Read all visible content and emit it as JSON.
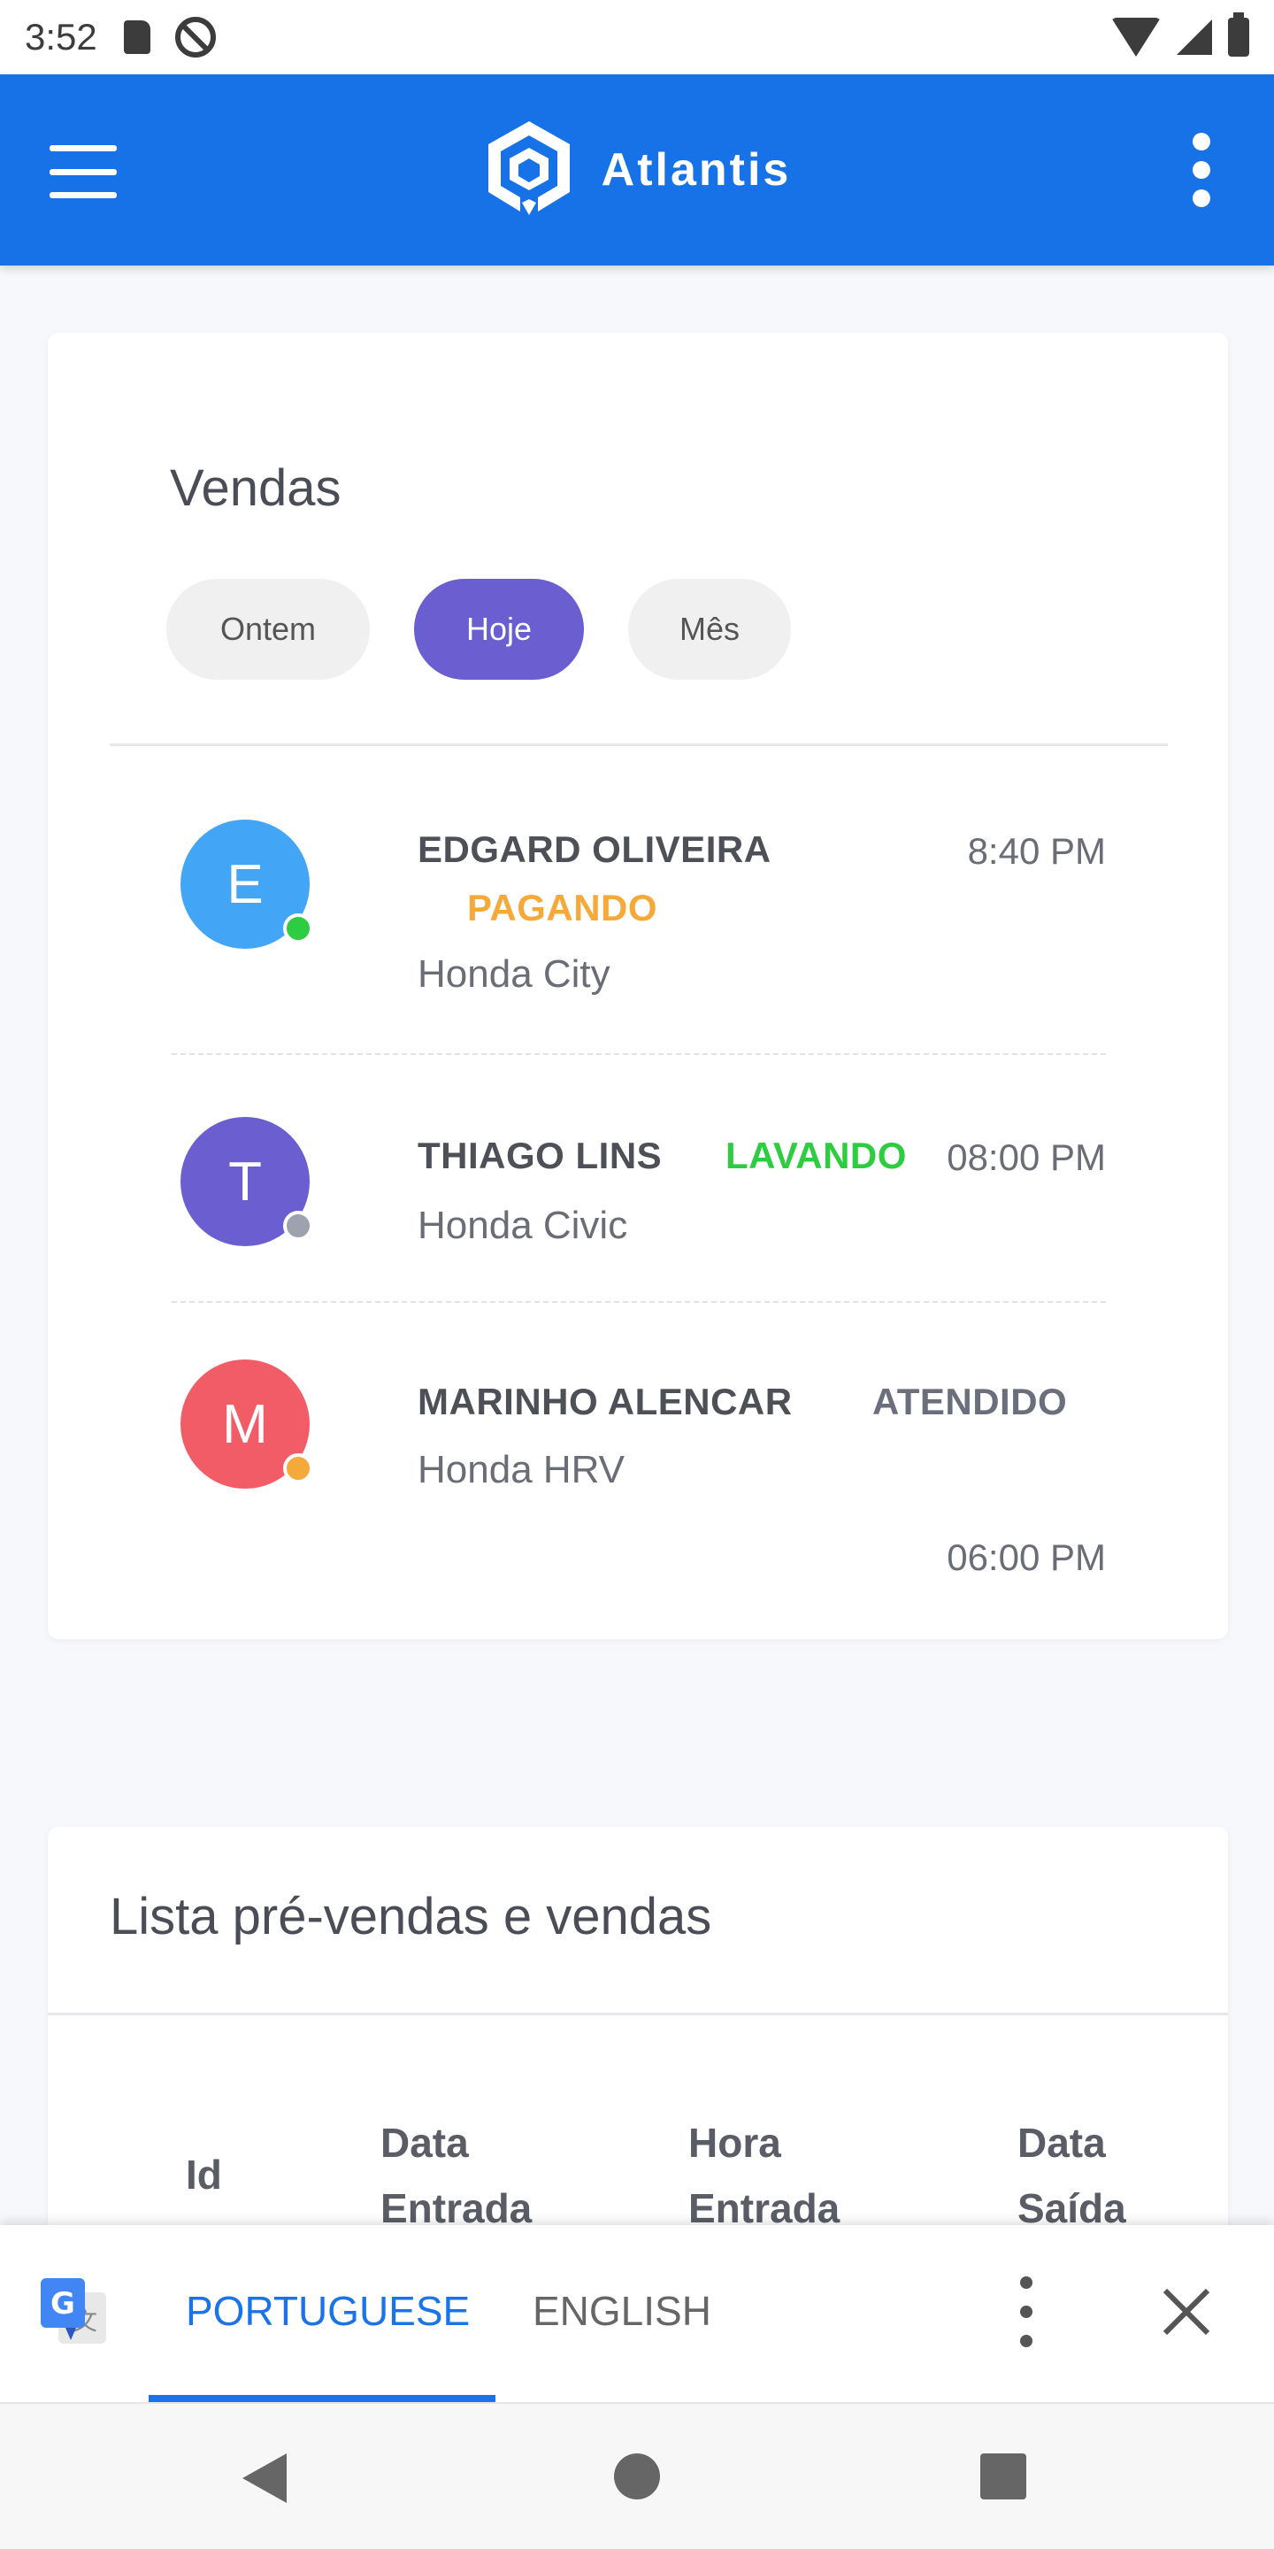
{
  "status_bar": {
    "time": "3:52"
  },
  "app_bar": {
    "title": "Atlantis"
  },
  "sales": {
    "title": "Vendas",
    "filters": [
      "Ontem",
      "Hoje",
      "Mês"
    ],
    "active_filter": "Hoje",
    "items": [
      {
        "initial": "E",
        "name": "EDGARD OLIVEIRA",
        "status": "PAGANDO",
        "vehicle": "Honda City",
        "time": "8:40 PM",
        "avatar_color": "#42a5f5",
        "status_color": "#f6a93b",
        "presence_color": "#2ecc40"
      },
      {
        "initial": "T",
        "name": "THIAGO LINS",
        "status": "LAVANDO",
        "vehicle": "Honda Civic",
        "time": "08:00 PM",
        "avatar_color": "#6a5ed0",
        "status_color": "#2ecc40",
        "presence_color": "#9ca3af"
      },
      {
        "initial": "M",
        "name": "MARINHO ALENCAR",
        "status": "ATENDIDO",
        "vehicle": "Honda HRV",
        "time": "06:00 PM",
        "avatar_color": "#f25c66",
        "status_color": "#6b6f7b",
        "presence_color": "#f6a93b"
      }
    ]
  },
  "list": {
    "title": "Lista pré-vendas e vendas",
    "columns": [
      "Id",
      "Data Entrada",
      "Hora Entrada",
      "Data Saída"
    ]
  },
  "translate_bar": {
    "languages": [
      "PORTUGUESE",
      "ENGLISH"
    ],
    "active_language": "PORTUGUESE"
  },
  "colors": {
    "primary": "#1672e6",
    "accent": "#6a5ed0",
    "translate_blue": "#1a73e8"
  }
}
